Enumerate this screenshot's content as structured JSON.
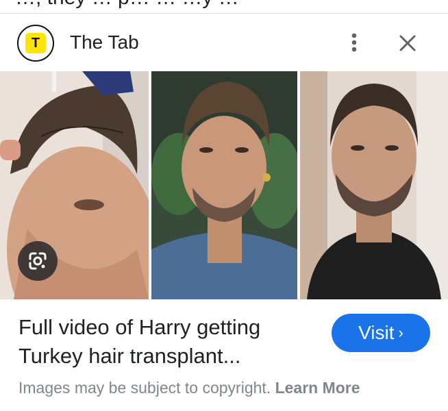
{
  "top_clip_text": "…, they … p… … …y …",
  "source": {
    "logo_letter": "T",
    "name": "The Tab"
  },
  "icons": {
    "more": "more-vert-icon",
    "close": "close-icon",
    "lens": "google-lens-icon"
  },
  "result": {
    "title_line1": "Full video of Harry getting",
    "title_line2": "Turkey hair transplant...",
    "visit_label": "Visit",
    "visit_chevron": "›"
  },
  "footer": {
    "copyright_text": "Images may be subject to copyright.",
    "learn_more": "Learn More"
  },
  "colors": {
    "accent": "#1a73e8",
    "logo_yellow": "#ffe500",
    "muted_text": "#80868b"
  }
}
